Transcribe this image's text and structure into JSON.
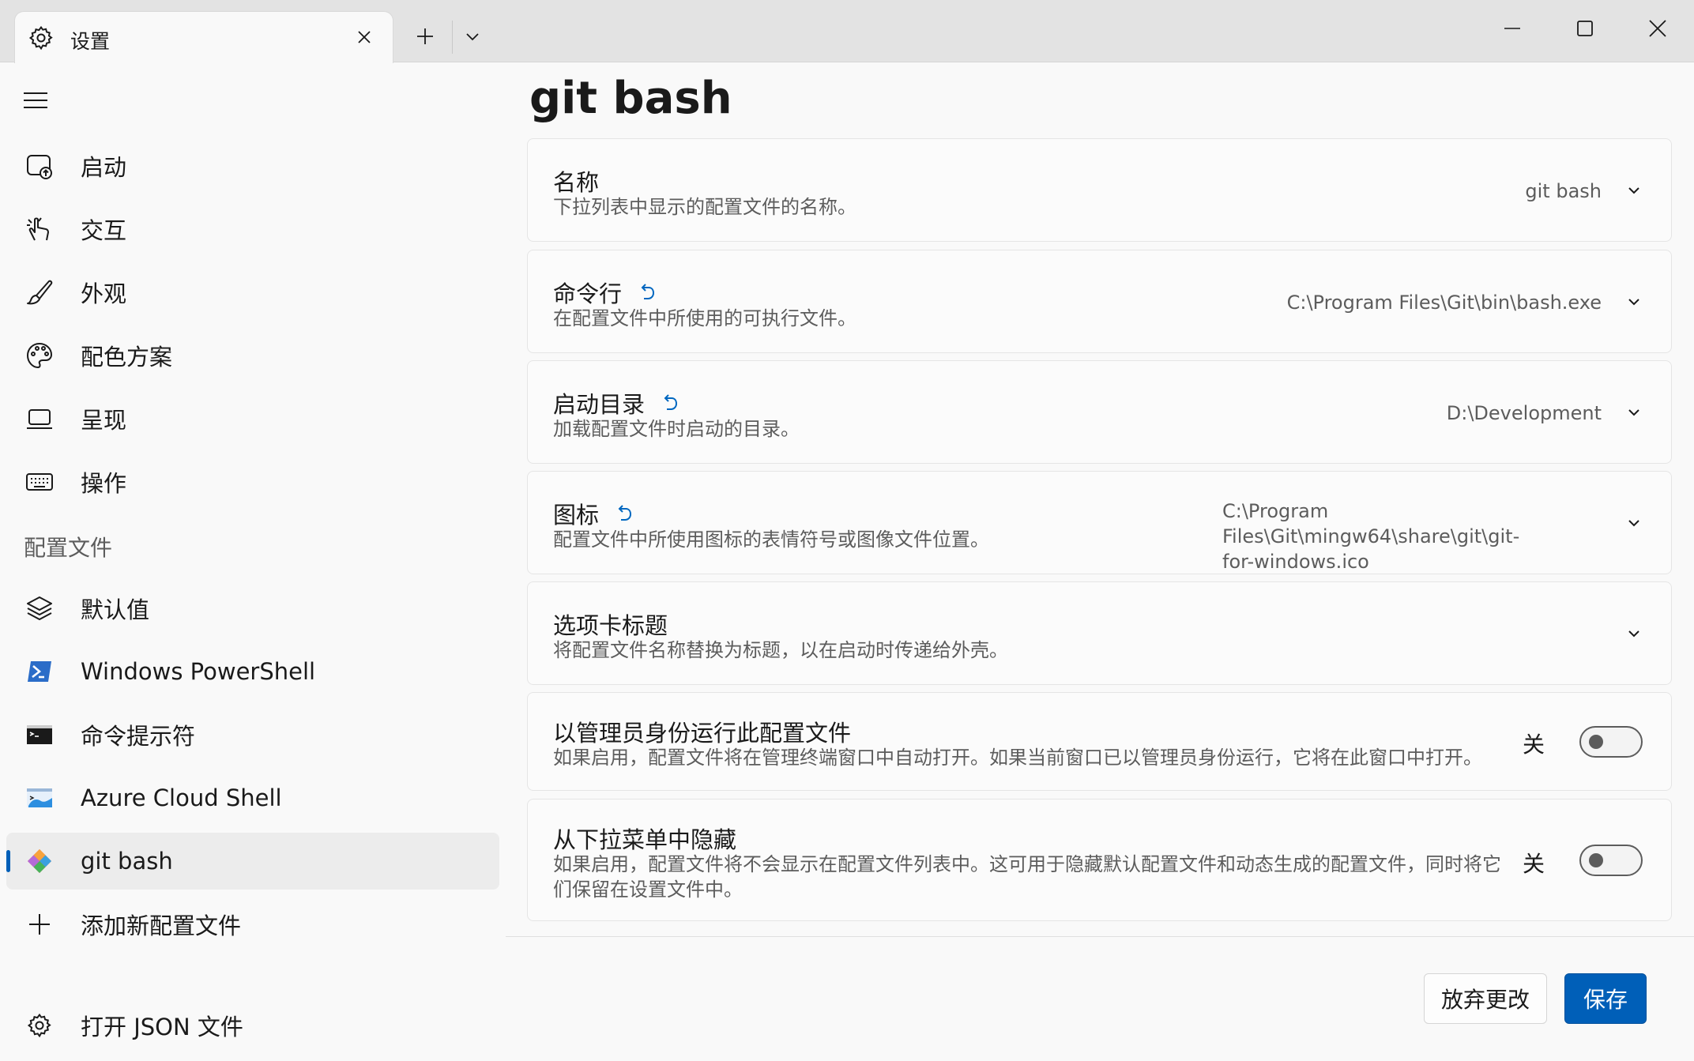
{
  "titlebar": {
    "tab_title": "设置",
    "new_tab_symbol": "+",
    "icons": [
      "gear-icon",
      "close-icon",
      "plus-icon",
      "chevron-down-icon",
      "minimize-icon",
      "maximize-icon",
      "close-window-icon"
    ]
  },
  "sidebar": {
    "items": [
      {
        "label": "启动",
        "icon": "startup-icon"
      },
      {
        "label": "交互",
        "icon": "interaction-icon"
      },
      {
        "label": "外观",
        "icon": "brush-icon"
      },
      {
        "label": "配色方案",
        "icon": "palette-icon"
      },
      {
        "label": "呈现",
        "icon": "monitor-icon"
      },
      {
        "label": "操作",
        "icon": "keyboard-icon"
      }
    ],
    "section_label": "配置文件",
    "profiles": [
      {
        "label": "默认值",
        "icon": "layers-icon"
      },
      {
        "label": "Windows PowerShell",
        "icon": "powershell-icon"
      },
      {
        "label": "命令提示符",
        "icon": "cmd-icon"
      },
      {
        "label": "Azure Cloud Shell",
        "icon": "azure-icon"
      },
      {
        "label": "git bash",
        "icon": "git-icon",
        "active": true
      },
      {
        "label": "添加新配置文件",
        "icon": "plus-icon"
      }
    ],
    "open_json": "打开 JSON 文件"
  },
  "main": {
    "title": "git bash",
    "settings": [
      {
        "title": "名称",
        "desc": "下拉列表中显示的配置文件的名称。",
        "value": "git bash"
      },
      {
        "title": "命令行",
        "desc": "在配置文件中所使用的可执行文件。",
        "value": "C:\\Program Files\\Git\\bin\\bash.exe"
      },
      {
        "title": "启动目录",
        "desc": "加载配置文件时启动的目录。",
        "value": "D:\\Development"
      },
      {
        "title": "图标",
        "desc": "配置文件中所使用图标的表情符号或图像文件位置。",
        "value_line1": "C:\\Program Files\\Git\\mingw64\\share\\git\\git-",
        "value_line2": "for-windows.ico"
      },
      {
        "title": "选项卡标题",
        "desc": "将配置文件名称替换为标题，以在启动时传递给外壳。"
      },
      {
        "title": "以管理员身份运行此配置文件",
        "desc": "如果启用，配置文件将在管理终端窗口中自动打开。如果当前窗口已以管理员身份运行，它将在此窗口中打开。",
        "toggle_label": "关"
      },
      {
        "title": "从下拉菜单中隐藏",
        "desc_line1": "如果启用，配置文件将不会显示在配置文件列表中。这可用于隐藏默认配置文件和动态生成的配置文件，同时将它",
        "desc_line2": "们保留在设置文件中。",
        "toggle_label": "关"
      }
    ]
  },
  "footer": {
    "discard_label": "放弃更改",
    "save_label": "保存"
  },
  "colors": {
    "accent": "#005fb8",
    "reset_icon": "#0067c0"
  }
}
